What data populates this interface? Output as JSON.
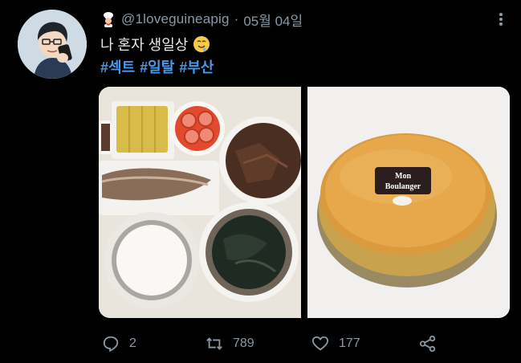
{
  "tweet": {
    "handle": "@1loveguineapig",
    "separator": "·",
    "date": "05월 04일",
    "text": "나 혼자 생일상",
    "hashtags": [
      "#섹트",
      "#일탈",
      "#부산"
    ]
  },
  "media": {
    "cake_label_line1": "Mon",
    "cake_label_line2": "Boulanger"
  },
  "actions": {
    "replies": "2",
    "retweets": "789",
    "likes": "177"
  },
  "colors": {
    "background": "#000000",
    "text": "#e7e9ea",
    "muted": "#8b98a5",
    "link": "#4a99e9"
  },
  "icons": [
    "chef-avatar-icon",
    "more-icon",
    "drooling-face-emoji",
    "reply-icon",
    "retweet-icon",
    "like-icon",
    "share-icon"
  ]
}
